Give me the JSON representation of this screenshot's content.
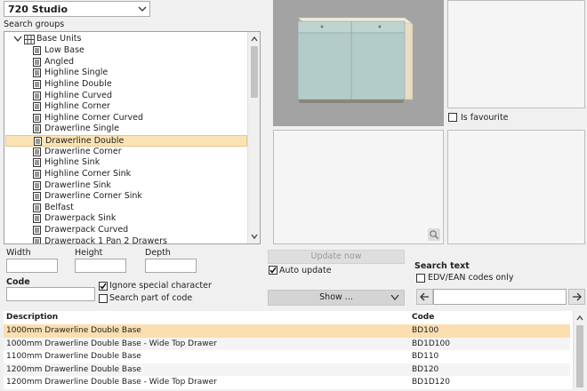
{
  "range_select": {
    "value": "720 Studio"
  },
  "search_groups": {
    "label": "Search groups",
    "root": "Base Units",
    "items": [
      "Low Base",
      "Angled",
      "Highline Single",
      "Highline Double",
      "Highline Curved",
      "Highline Corner",
      "Highline Corner Curved",
      "Drawerline Single",
      "Drawerline Double",
      "Drawerline Corner",
      "Highline Sink",
      "Highline Corner Sink",
      "Drawerline Sink",
      "Drawerline Corner Sink",
      "Belfast",
      "Drawerpack Sink",
      "Drawerpack Curved",
      "Drawerpack 1 Pan 2 Drawers"
    ],
    "selected": "Drawerline Double"
  },
  "dimensions": {
    "width_label": "Width",
    "height_label": "Height",
    "depth_label": "Depth",
    "width": "",
    "height": "",
    "depth": ""
  },
  "code": {
    "label": "Code",
    "value": "",
    "ignore_special_label": "Ignore special character",
    "search_part_label": "Search part of code"
  },
  "controls": {
    "update_now": "Update now",
    "auto_update": "Auto update",
    "show": "Show ...",
    "is_favourite": "Is favourite"
  },
  "search_text": {
    "label": "Search text",
    "edv_label": "EDV/EAN codes only",
    "value": ""
  },
  "results": {
    "headers": {
      "description": "Description",
      "code": "Code"
    },
    "rows": [
      {
        "description": "1000mm Drawerline Double Base",
        "code": "BD100"
      },
      {
        "description": "1000mm Drawerline Double Base - Wide Top Drawer",
        "code": "BD1D100"
      },
      {
        "description": "1100mm Drawerline Double Base",
        "code": "BD110"
      },
      {
        "description": "1200mm Drawerline Double Base",
        "code": "BD120"
      },
      {
        "description": "1200mm Drawerline Double Base - Wide Top Drawer",
        "code": "BD1D120"
      }
    ]
  },
  "colors": {
    "selection": "#fbe3b3",
    "preview_bg": "#a3a3a3",
    "cabinet_front": "#b4ccc8"
  }
}
